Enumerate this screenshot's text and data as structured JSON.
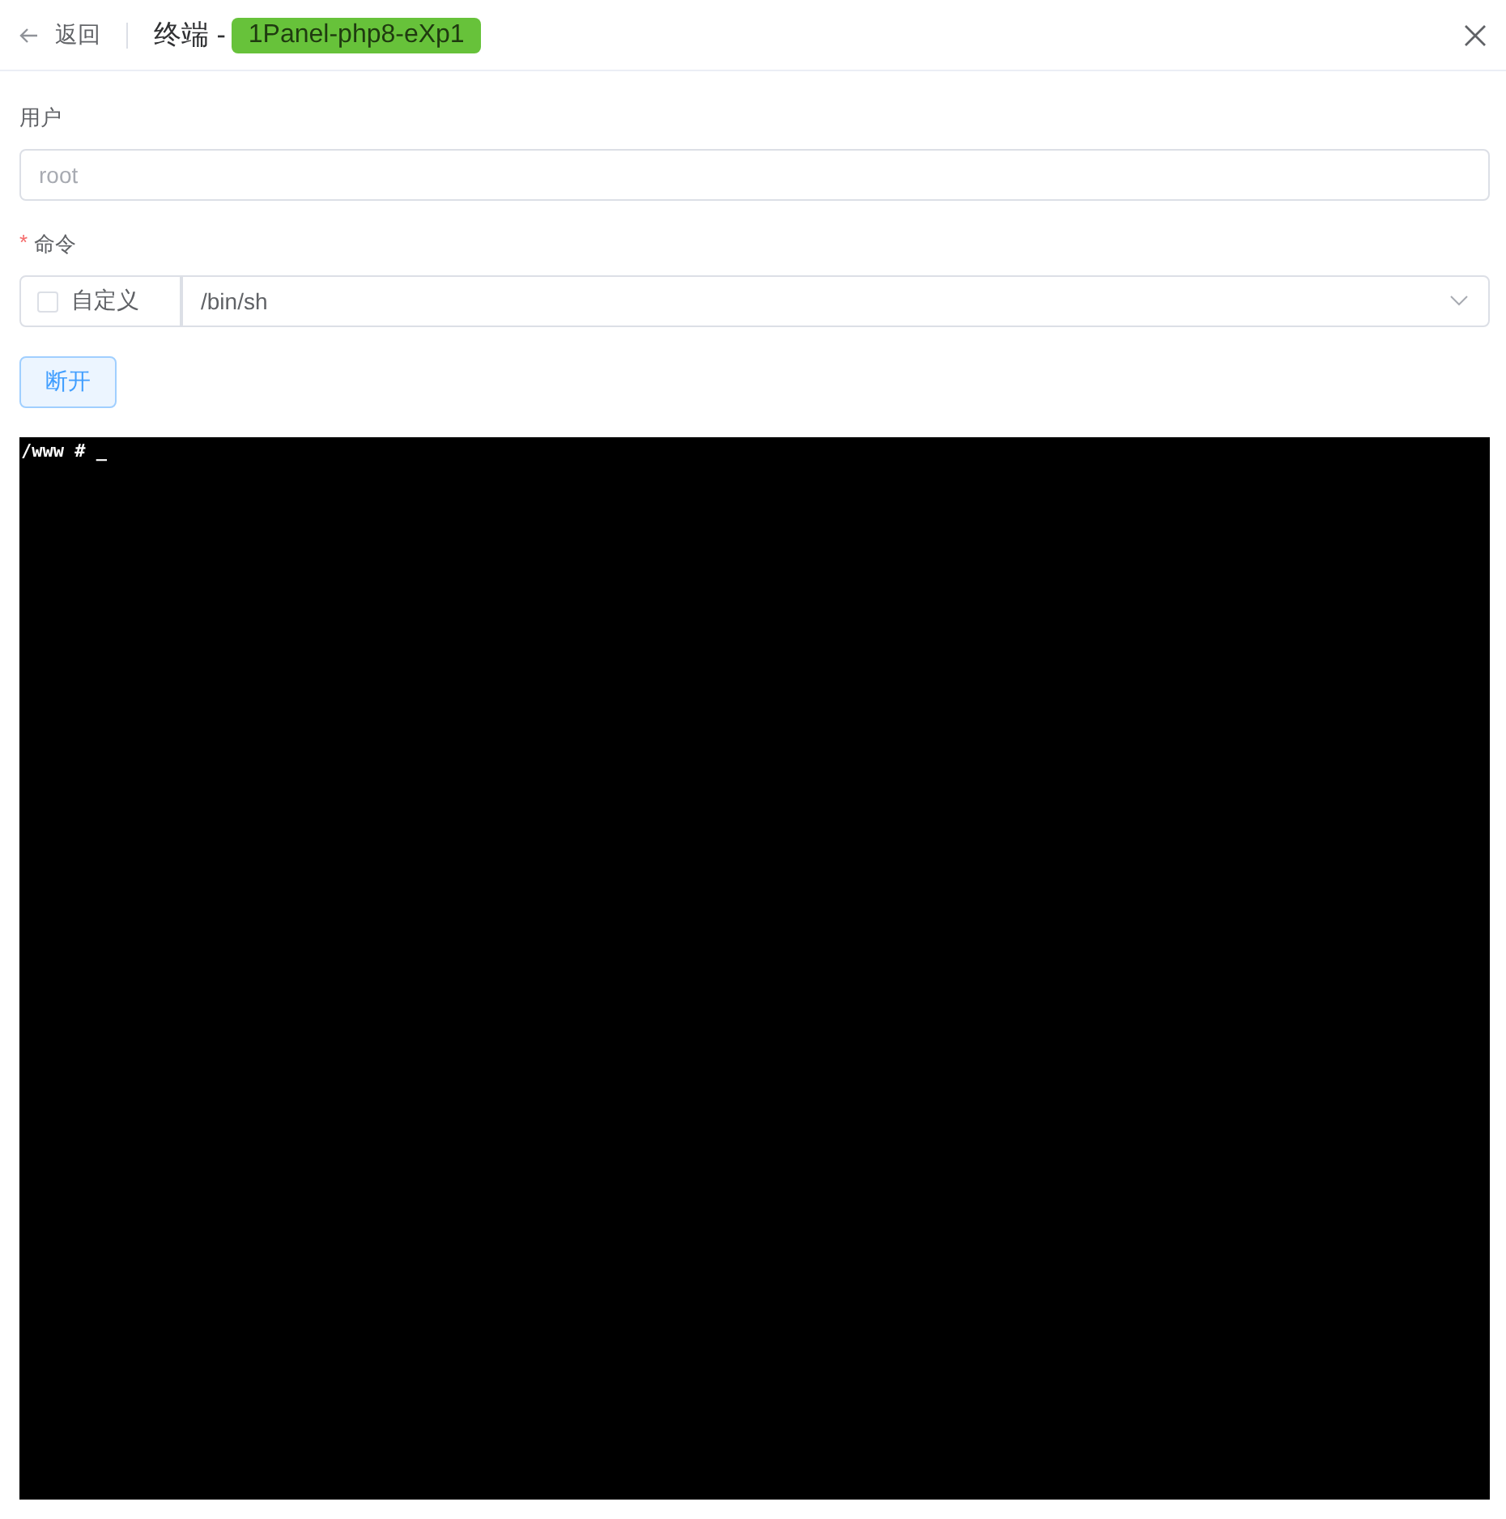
{
  "header": {
    "back_label": "返回",
    "title": "终端 -",
    "container_tag": "1Panel-php8-eXp1"
  },
  "form": {
    "user": {
      "label": "用户",
      "placeholder": "root"
    },
    "command": {
      "label": "命令",
      "required_mark": "*",
      "custom": {
        "label": "自定义",
        "checked": false
      },
      "value": "/bin/sh"
    },
    "disconnect_button": "断开"
  },
  "terminal": {
    "lines": [
      "/www # _"
    ]
  }
}
